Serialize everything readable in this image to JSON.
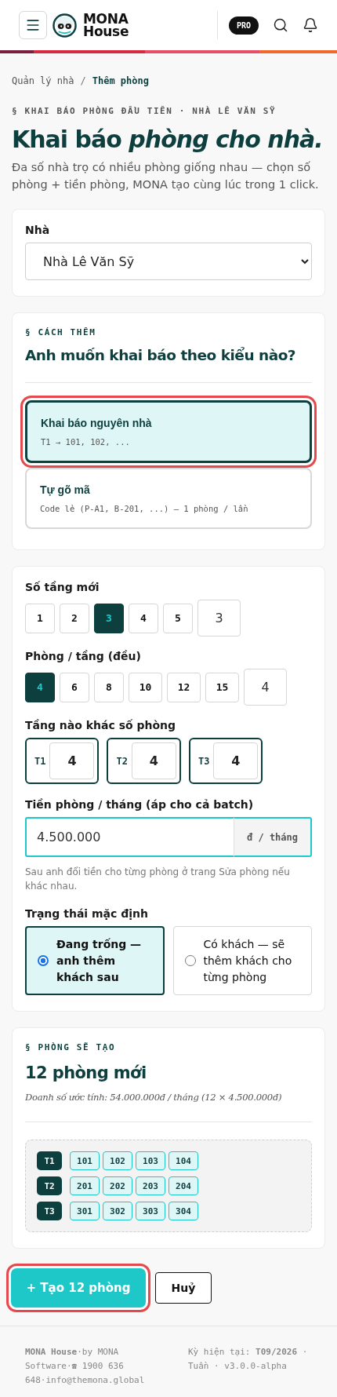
{
  "header": {
    "brand_line1": "MONA",
    "brand_line2": "House",
    "badge": "PRO"
  },
  "breadcrumb_separator": "/",
  "breadcrumb": [
    {
      "label": "Quản lý nhà",
      "current": false
    },
    {
      "label": "Thêm phòng",
      "current": true
    }
  ],
  "eyebrow": "§ KHAI BÁO PHÒNG ĐẦU TIÊN · NHÀ LÊ VĂN SỸ",
  "title": "Khai báo *phòng cho nhà.*",
  "description": "Đa số nhà trọ có nhiều phòng giống nhau — chọn số phòng + tiền phòng, MONA tạo cùng lúc trong 1 click.",
  "house": {
    "label": "Nhà",
    "value": "Nhà Lê Văn Sỹ"
  },
  "method": {
    "eyebrow": "§ CÁCH THÊM",
    "question": "Anh muốn khai báo theo kiểu nào?",
    "options": [
      {
        "title": "Khai báo nguyên nhà",
        "hint": "T1 → 101, 102, ...",
        "selected": true
      },
      {
        "title": "Tự gõ mã",
        "hint": "Code lẻ (P-A1, B-201, ...) — 1 phòng / lần",
        "selected": false
      }
    ]
  },
  "floors": {
    "label": "Số tầng mới",
    "options": [
      {
        "label": "1",
        "selected": false
      },
      {
        "label": "2",
        "selected": false
      },
      {
        "label": "3",
        "selected": true
      },
      {
        "label": "4",
        "selected": false
      },
      {
        "label": "5",
        "selected": false
      }
    ],
    "input_value": "3"
  },
  "rooms_per_floor": {
    "label": "Phòng / tầng (đều)",
    "options": [
      {
        "label": "4",
        "selected": true
      },
      {
        "label": "6",
        "selected": false
      },
      {
        "label": "8",
        "selected": false
      },
      {
        "label": "10",
        "selected": false
      },
      {
        "label": "12",
        "selected": false
      },
      {
        "label": "15",
        "selected": false
      }
    ],
    "input_value": "4"
  },
  "per_floor": {
    "label": "Tầng nào khác số phòng",
    "floors": [
      {
        "label": "T1",
        "value": "4"
      },
      {
        "label": "T2",
        "value": "4"
      },
      {
        "label": "T3",
        "value": "4"
      }
    ]
  },
  "rent": {
    "label": "Tiền phòng / tháng (áp cho cả batch)",
    "value": "4.500.000",
    "unit": "đ / tháng",
    "note": "Sau anh đổi tiền cho từng phòng ở trang Sửa phòng nếu khác nhau."
  },
  "default_status": {
    "label": "Trạng thái mặc định",
    "options": [
      {
        "label": "Đang trống — anh thêm khách sau",
        "selected": true
      },
      {
        "label": "Có khách — sẽ thêm khách cho từng phòng",
        "selected": false
      }
    ]
  },
  "preview": {
    "eyebrow": "§ PHÒNG SẼ TẠO",
    "title": "12 phòng mới",
    "estimate": "Doanh số ước tính: 54.000.000đ / tháng (12 × 4.500.000đ)",
    "rows": [
      {
        "floor": "T1",
        "rooms": [
          "101",
          "102",
          "103",
          "104"
        ]
      },
      {
        "floor": "T2",
        "rooms": [
          "201",
          "202",
          "203",
          "204"
        ]
      },
      {
        "floor": "T3",
        "rooms": [
          "301",
          "302",
          "303",
          "304"
        ]
      }
    ]
  },
  "actions": {
    "primary": "+ Tạo 12 phòng",
    "secondary": "Huỷ"
  },
  "footer": {
    "left": "**MONA House**·by MONA Software·☎ 1900 636 648·info@themona.global",
    "right": "Kỳ hiện tại: **T09/2026** · Tuần · v3.0.0-alpha"
  }
}
